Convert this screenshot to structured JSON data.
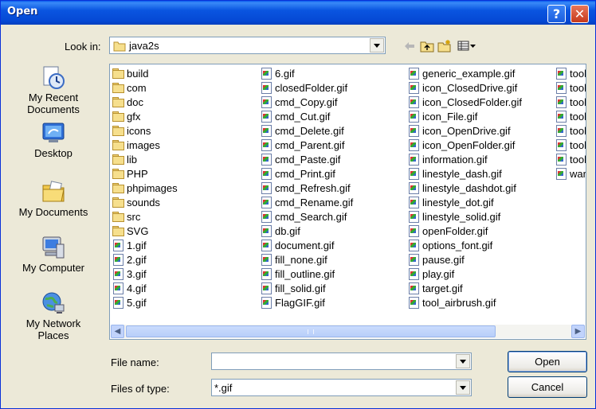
{
  "window": {
    "title": "Open"
  },
  "titlebar": {
    "help_icon": "help-icon",
    "close_icon": "close-icon"
  },
  "toolbar": {
    "lookin_label": "Look in:",
    "lookin_value": "java2s",
    "icons": [
      "back-icon",
      "up-folder-icon",
      "new-folder-icon",
      "view-menu-icon"
    ]
  },
  "places": [
    {
      "label": "My Recent Documents",
      "lines": [
        "My Recent",
        "Documents"
      ],
      "icon": "recent-documents-icon"
    },
    {
      "label": "Desktop",
      "lines": [
        "Desktop"
      ],
      "icon": "desktop-icon"
    },
    {
      "label": "My Documents",
      "lines": [
        "My Documents"
      ],
      "icon": "my-documents-icon"
    },
    {
      "label": "My Computer",
      "lines": [
        "My Computer"
      ],
      "icon": "my-computer-icon"
    },
    {
      "label": "My Network Places",
      "lines": [
        "My Network",
        "Places"
      ],
      "icon": "network-places-icon"
    }
  ],
  "files": {
    "columns": [
      [
        {
          "name": "build",
          "type": "folder"
        },
        {
          "name": "com",
          "type": "folder"
        },
        {
          "name": "doc",
          "type": "folder"
        },
        {
          "name": "gfx",
          "type": "folder"
        },
        {
          "name": "icons",
          "type": "folder"
        },
        {
          "name": "images",
          "type": "folder"
        },
        {
          "name": "lib",
          "type": "folder"
        },
        {
          "name": "PHP",
          "type": "folder"
        },
        {
          "name": "phpimages",
          "type": "folder"
        },
        {
          "name": "sounds",
          "type": "folder"
        },
        {
          "name": "src",
          "type": "folder"
        },
        {
          "name": "SVG",
          "type": "folder"
        },
        {
          "name": "1.gif",
          "type": "gif"
        },
        {
          "name": "2.gif",
          "type": "gif"
        },
        {
          "name": "3.gif",
          "type": "gif"
        },
        {
          "name": "4.gif",
          "type": "gif"
        },
        {
          "name": "5.gif",
          "type": "gif"
        }
      ],
      [
        {
          "name": "6.gif",
          "type": "gif"
        },
        {
          "name": "closedFolder.gif",
          "type": "gif"
        },
        {
          "name": "cmd_Copy.gif",
          "type": "gif"
        },
        {
          "name": "cmd_Cut.gif",
          "type": "gif"
        },
        {
          "name": "cmd_Delete.gif",
          "type": "gif"
        },
        {
          "name": "cmd_Parent.gif",
          "type": "gif"
        },
        {
          "name": "cmd_Paste.gif",
          "type": "gif"
        },
        {
          "name": "cmd_Print.gif",
          "type": "gif"
        },
        {
          "name": "cmd_Refresh.gif",
          "type": "gif"
        },
        {
          "name": "cmd_Rename.gif",
          "type": "gif"
        },
        {
          "name": "cmd_Search.gif",
          "type": "gif"
        },
        {
          "name": "db.gif",
          "type": "gif"
        },
        {
          "name": "document.gif",
          "type": "gif"
        },
        {
          "name": "fill_none.gif",
          "type": "gif"
        },
        {
          "name": "fill_outline.gif",
          "type": "gif"
        },
        {
          "name": "fill_solid.gif",
          "type": "gif"
        },
        {
          "name": "FlagGIF.gif",
          "type": "gif"
        }
      ],
      [
        {
          "name": "generic_example.gif",
          "type": "gif"
        },
        {
          "name": "icon_ClosedDrive.gif",
          "type": "gif"
        },
        {
          "name": "icon_ClosedFolder.gif",
          "type": "gif"
        },
        {
          "name": "icon_File.gif",
          "type": "gif"
        },
        {
          "name": "icon_OpenDrive.gif",
          "type": "gif"
        },
        {
          "name": "icon_OpenFolder.gif",
          "type": "gif"
        },
        {
          "name": "information.gif",
          "type": "gif"
        },
        {
          "name": "linestyle_dash.gif",
          "type": "gif"
        },
        {
          "name": "linestyle_dashdot.gif",
          "type": "gif"
        },
        {
          "name": "linestyle_dot.gif",
          "type": "gif"
        },
        {
          "name": "linestyle_solid.gif",
          "type": "gif"
        },
        {
          "name": "openFolder.gif",
          "type": "gif"
        },
        {
          "name": "options_font.gif",
          "type": "gif"
        },
        {
          "name": "pause.gif",
          "type": "gif"
        },
        {
          "name": "play.gif",
          "type": "gif"
        },
        {
          "name": "target.gif",
          "type": "gif"
        },
        {
          "name": "tool_airbrush.gif",
          "type": "gif"
        }
      ],
      [
        {
          "name": "tool",
          "type": "gif"
        },
        {
          "name": "tool",
          "type": "gif"
        },
        {
          "name": "tool",
          "type": "gif"
        },
        {
          "name": "tool",
          "type": "gif"
        },
        {
          "name": "tool",
          "type": "gif"
        },
        {
          "name": "tool",
          "type": "gif"
        },
        {
          "name": "tool",
          "type": "gif"
        },
        {
          "name": "warı",
          "type": "gif"
        }
      ]
    ]
  },
  "form": {
    "filename_label": "File name:",
    "filename_value": "",
    "filetype_label": "Files of type:",
    "filetype_value": "*.gif"
  },
  "buttons": {
    "open": "Open",
    "cancel": "Cancel"
  },
  "colors": {
    "titlebar": "#0a55e0",
    "dialog_bg": "#ece9d8",
    "list_border": "#7f9db9"
  }
}
